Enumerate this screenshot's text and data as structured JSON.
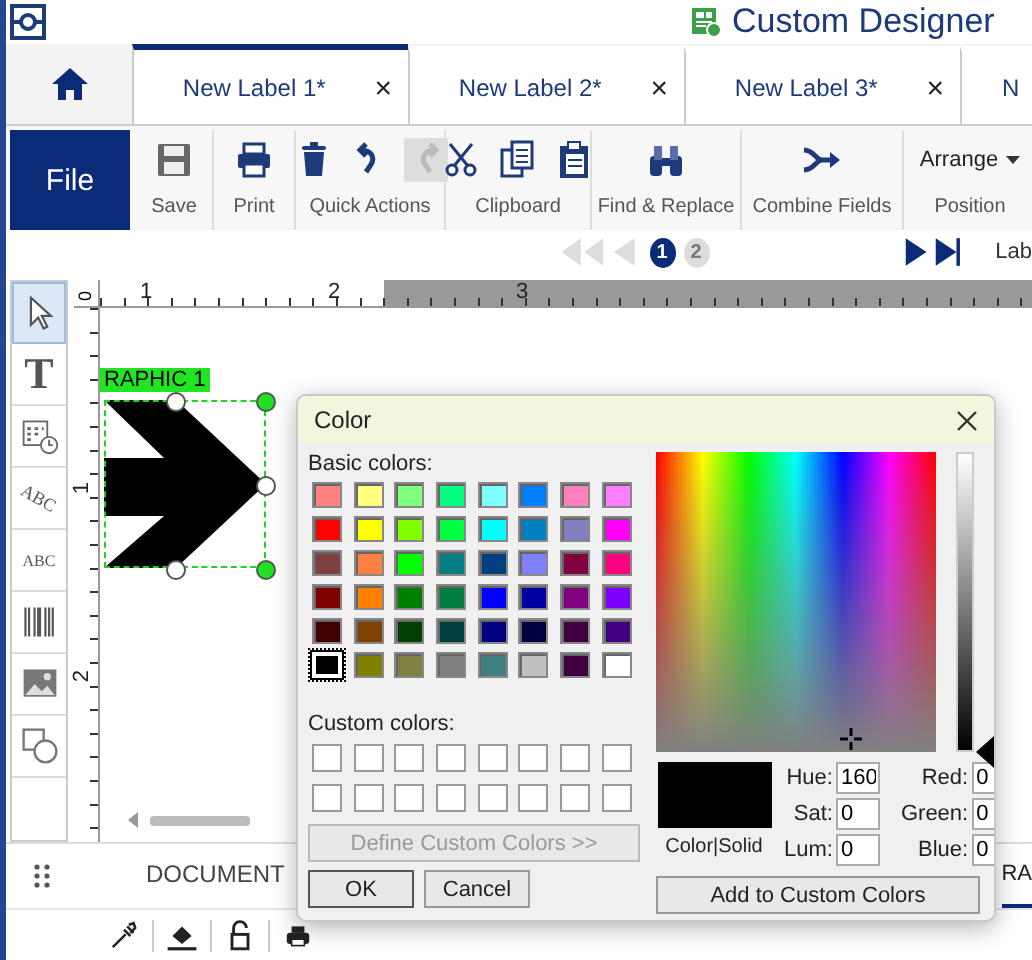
{
  "app": {
    "title": "Custom Designer"
  },
  "tabs": [
    {
      "label": "New Label 1*",
      "close": "×",
      "selected": true
    },
    {
      "label": "New Label 2*",
      "close": "×",
      "selected": false
    },
    {
      "label": "New Label 3*",
      "close": "×",
      "selected": false
    },
    {
      "label": "N",
      "selected": false
    }
  ],
  "ribbon": {
    "file_button": "File",
    "groups": [
      {
        "label": "Save",
        "tools": [
          {
            "kind": "save",
            "disabled": false
          }
        ]
      },
      {
        "label": "Print",
        "tools": [
          {
            "kind": "print",
            "disabled": false
          }
        ]
      },
      {
        "label": "Quick Actions",
        "tools": [
          {
            "kind": "delete",
            "disabled": false
          },
          {
            "kind": "undo",
            "disabled": false
          },
          {
            "kind": "redo",
            "disabled": true
          }
        ]
      },
      {
        "label": "Clipboard",
        "tools": [
          {
            "kind": "cut",
            "disabled": false
          },
          {
            "kind": "copy",
            "disabled": false
          },
          {
            "kind": "paste",
            "disabled": false
          }
        ]
      },
      {
        "label": "Find & Replace",
        "tools": [
          {
            "kind": "find",
            "disabled": false
          }
        ]
      },
      {
        "label": "Combine Fields",
        "tools": [
          {
            "kind": "combine",
            "disabled": false
          }
        ]
      },
      {
        "label": "Position",
        "menu": "Arrange"
      }
    ]
  },
  "page_nav": {
    "back_disabled": true,
    "forward_disabled": false,
    "pages": [
      {
        "label": "1",
        "selected": true
      },
      {
        "label": "2",
        "selected": false
      }
    ],
    "trailing_label": "Lab"
  },
  "tools": [
    {
      "kind": "pointer",
      "selected": true
    },
    {
      "kind": "text",
      "glyph": "T",
      "selected": false
    },
    {
      "kind": "datetime",
      "selected": false
    },
    {
      "kind": "curved_text",
      "glyph": "ABC",
      "selected": false
    },
    {
      "kind": "small_text",
      "glyph": "ABC",
      "selected": false
    },
    {
      "kind": "barcode",
      "selected": false
    },
    {
      "kind": "image",
      "selected": false
    },
    {
      "kind": "shapes",
      "selected": false
    }
  ],
  "ruler": {
    "corner": "0",
    "top_numbers": [
      "1",
      "2",
      "3"
    ],
    "left_numbers": [
      "1",
      "2"
    ]
  },
  "canvas": {
    "objects": [
      {
        "kind": "graphic",
        "tag": "RAPHIC 1",
        "selected": true
      }
    ]
  },
  "bottom_panel": {
    "tabs": [
      {
        "label": "DOCUMENT",
        "selected": false
      },
      {
        "label": "RA",
        "selected": true
      }
    ],
    "tools": [
      {
        "kind": "eyedropper"
      },
      {
        "kind": "fill"
      },
      {
        "kind": "lock"
      },
      {
        "kind": "print"
      }
    ]
  },
  "color_dialog": {
    "title": "Color",
    "basic_label": "Basic colors:",
    "basic_colors": [
      {
        "color": "#ff8080",
        "selected": false
      },
      {
        "color": "#ffff80",
        "selected": false
      },
      {
        "color": "#80ff80",
        "selected": false
      },
      {
        "color": "#00ff80",
        "selected": false
      },
      {
        "color": "#80ffff",
        "selected": false
      },
      {
        "color": "#0080ff",
        "selected": false
      },
      {
        "color": "#ff80c0",
        "selected": false
      },
      {
        "color": "#ff80ff",
        "selected": false
      },
      {
        "color": "#ff0000",
        "selected": false
      },
      {
        "color": "#ffff00",
        "selected": false
      },
      {
        "color": "#80ff00",
        "selected": false
      },
      {
        "color": "#00ff40",
        "selected": false
      },
      {
        "color": "#00ffff",
        "selected": false
      },
      {
        "color": "#0080c0",
        "selected": false
      },
      {
        "color": "#8080c0",
        "selected": false
      },
      {
        "color": "#ff00ff",
        "selected": false
      },
      {
        "color": "#804040",
        "selected": false
      },
      {
        "color": "#ff8040",
        "selected": false
      },
      {
        "color": "#00ff00",
        "selected": false
      },
      {
        "color": "#008080",
        "selected": false
      },
      {
        "color": "#004080",
        "selected": false
      },
      {
        "color": "#8080ff",
        "selected": false
      },
      {
        "color": "#800040",
        "selected": false
      },
      {
        "color": "#ff0080",
        "selected": false
      },
      {
        "color": "#800000",
        "selected": false
      },
      {
        "color": "#ff8000",
        "selected": false
      },
      {
        "color": "#008000",
        "selected": false
      },
      {
        "color": "#008040",
        "selected": false
      },
      {
        "color": "#0000ff",
        "selected": false
      },
      {
        "color": "#0000a0",
        "selected": false
      },
      {
        "color": "#800080",
        "selected": false
      },
      {
        "color": "#8000ff",
        "selected": false
      },
      {
        "color": "#400000",
        "selected": false
      },
      {
        "color": "#804000",
        "selected": false
      },
      {
        "color": "#004000",
        "selected": false
      },
      {
        "color": "#004040",
        "selected": false
      },
      {
        "color": "#000080",
        "selected": false
      },
      {
        "color": "#000040",
        "selected": false
      },
      {
        "color": "#400040",
        "selected": false
      },
      {
        "color": "#400080",
        "selected": false
      },
      {
        "color": "#000000",
        "selected": true
      },
      {
        "color": "#808000",
        "selected": false
      },
      {
        "color": "#808040",
        "selected": false
      },
      {
        "color": "#808080",
        "selected": false
      },
      {
        "color": "#408080",
        "selected": false
      },
      {
        "color": "#c0c0c0",
        "selected": false
      },
      {
        "color": "#400040",
        "selected": false
      },
      {
        "color": "#ffffff",
        "selected": false
      }
    ],
    "custom_label": "Custom colors:",
    "define_button": {
      "label": "Define Custom Colors >>",
      "disabled": true
    },
    "ok_button": "OK",
    "cancel_button": "Cancel",
    "preview": {
      "color": "#000000",
      "label": "Color|Solid"
    },
    "fields": [
      {
        "label": "Hue:",
        "value": "160"
      },
      {
        "label": "Red:",
        "value": "0"
      },
      {
        "label": "Sat:",
        "value": "0"
      },
      {
        "label": "Green:",
        "value": "0"
      },
      {
        "label": "Lum:",
        "value": "0"
      },
      {
        "label": "Blue:",
        "value": "0"
      }
    ],
    "luminance": {
      "level": 0
    },
    "add_button": "Add to Custom Colors"
  }
}
